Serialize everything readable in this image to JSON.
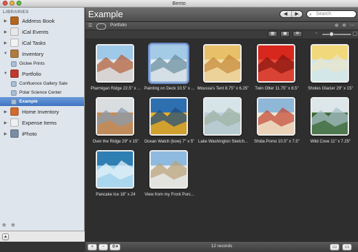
{
  "window": {
    "title": "Bento",
    "lights": {
      "close": "#e9574f",
      "minimize": "#e9b43f",
      "zoom": "#5ac13c"
    }
  },
  "sidebar": {
    "header": "LIBRARIES",
    "items": [
      {
        "label": "Address Book",
        "icon": "address-book-icon",
        "color": "#b5651d",
        "level": 0,
        "expanded": false
      },
      {
        "label": "iCal Events",
        "icon": "calendar-icon",
        "color": "#e8e8e8",
        "level": 0,
        "expanded": false
      },
      {
        "label": "iCal Tasks",
        "icon": "checklist-icon",
        "color": "#f2f2f2",
        "level": 0,
        "expanded": false
      },
      {
        "label": "Inventory",
        "icon": "inventory-icon",
        "color": "#b27b3c",
        "level": 0,
        "expanded": true
      },
      {
        "label": "Giclee Prints",
        "icon": "collection-icon",
        "color": "#a8bfd8",
        "level": 1
      },
      {
        "label": "Portfolio",
        "icon": "portfolio-icon",
        "color": "#c0392b",
        "level": 0,
        "expanded": true
      },
      {
        "label": "Confluence Gallery Sale",
        "icon": "collection-icon",
        "color": "#a8bfd8",
        "level": 1
      },
      {
        "label": "Polar Science Center",
        "icon": "collection-icon",
        "color": "#a8bfd8",
        "level": 1
      },
      {
        "label": "Example",
        "icon": "collection-icon",
        "color": "#a8bfd8",
        "level": 1,
        "selected": true
      },
      {
        "label": "Home Inventory",
        "icon": "home-icon",
        "color": "#d46a2c",
        "level": 0,
        "expanded": false
      },
      {
        "label": "Expense Items",
        "icon": "expense-icon",
        "color": "#f0f0f0",
        "level": 0,
        "expanded": false
      },
      {
        "label": "iPhoto",
        "icon": "iphoto-icon",
        "color": "#7a8da6",
        "level": 0,
        "expanded": false
      }
    ]
  },
  "toolbar": {
    "title": "Example",
    "search_placeholder": "Search",
    "back": "◀",
    "forward": "▶"
  },
  "filterbar": {
    "crumb": "Portfolio"
  },
  "gallery": {
    "items": [
      {
        "caption": "Ptarmigan Ridge 22.5\" x ...",
        "colors": [
          "#9fc9e8",
          "#dfe8ee",
          "#b4623c"
        ],
        "selected": false
      },
      {
        "caption": "Painting on Deck 10.5\" x ...",
        "colors": [
          "#a3cbe6",
          "#e7eef2",
          "#6a8d9f"
        ],
        "selected": true
      },
      {
        "caption": "Moussa's Tent 8.75\" x 6.25\"",
        "colors": [
          "#e8c06a",
          "#f2dfaa",
          "#c78a3a"
        ],
        "selected": false
      },
      {
        "caption": "Twin Otter 11.75\" x 8.5\"",
        "colors": [
          "#d8271c",
          "#e84b3a",
          "#8a1510"
        ],
        "selected": false
      },
      {
        "caption": "Sholes Glacier 29\" x 15\"",
        "colors": [
          "#f1d87a",
          "#cfe6ee",
          "#e8e6c8"
        ],
        "selected": false
      },
      {
        "caption": "Over the Ridge 29\" x 15\"",
        "colors": [
          "#d9dde0",
          "#c98a4c",
          "#8a9bb0"
        ],
        "selected": false
      },
      {
        "caption": "Ocean Watch (bow) 7\" x 5\"",
        "colors": [
          "#2e6fb0",
          "#f0b020",
          "#1d4d7d"
        ],
        "selected": false
      },
      {
        "caption": "Lake Washington Sketch...",
        "colors": [
          "#d6e4ea",
          "#bccfd8",
          "#9fb3a4"
        ],
        "selected": false
      },
      {
        "caption": "Shida Pomo 10.5\" x 7.5\"",
        "colors": [
          "#8fb7d8",
          "#f0ead0",
          "#c54b3a"
        ],
        "selected": false
      },
      {
        "caption": "Wild Cove 11\" x 7.25\"",
        "colors": [
          "#dde6e8",
          "#3e6b3a",
          "#a8c0c8"
        ],
        "selected": false
      },
      {
        "caption": "Pancake Ice 18\" x 24",
        "colors": [
          "#2f7fb3",
          "#9fd2ec",
          "#e5f3fa"
        ],
        "selected": false
      },
      {
        "caption": "View from my Front Porc...",
        "colors": [
          "#8fbadf",
          "#e9edf0",
          "#b9a27a"
        ],
        "selected": false
      }
    ]
  },
  "statusbar": {
    "record_count": "12 records"
  }
}
